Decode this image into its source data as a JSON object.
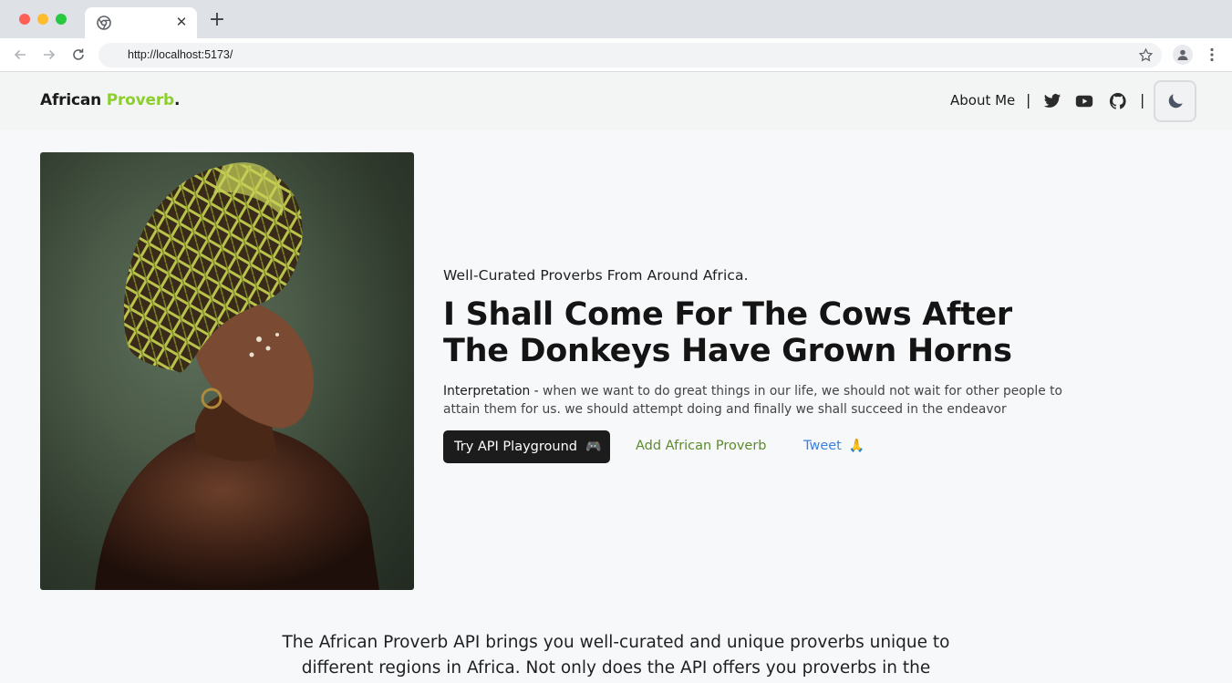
{
  "browser": {
    "url": "http://localhost:5173/"
  },
  "header": {
    "logo_primary": "African",
    "logo_accent": "Proverb",
    "logo_dot": ".",
    "about_label": "About Me",
    "separator": "|",
    "social": [
      "twitter-icon",
      "youtube-icon",
      "github-icon"
    ],
    "theme_icon": "moon-icon"
  },
  "hero": {
    "tagline": "Well-Curated Proverbs From Around Africa.",
    "headline": "I Shall Come For The Cows After The Donkeys Have Grown Horns",
    "interpretation_label": "Interpretation -",
    "interpretation_text": "when we want to do great things in our life, we should not wait for other people to attain them for us. we should attempt doing and finally we shall succeed in the endeavor",
    "primary_button": "Try API Playground",
    "primary_emoji": "🎮",
    "add_link": "Add African Proverb",
    "tweet_link": "Tweet",
    "tweet_emoji": "🙏"
  },
  "about": {
    "text": "The African Proverb API brings you well-curated and unique proverbs unique to different regions in Africa. Not only does the API offers you proverbs in the"
  },
  "colors": {
    "accent_green": "#8ccf2c",
    "link_green": "#5c8a2c",
    "link_blue": "#3b82e0",
    "dark": "#1c1c1c"
  }
}
